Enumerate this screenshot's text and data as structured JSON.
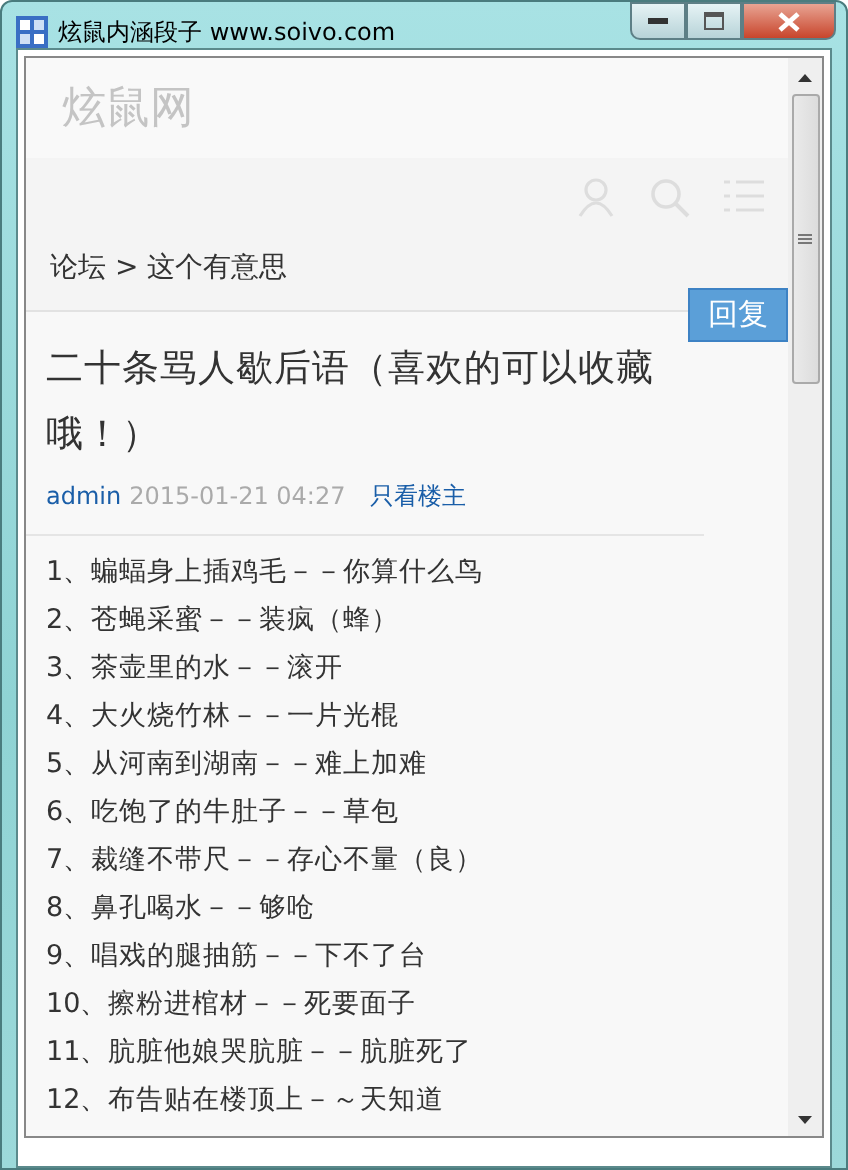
{
  "window": {
    "title": "炫鼠内涵段子 www.soivo.com"
  },
  "site": {
    "logo": "炫鼠网"
  },
  "breadcrumb": "论坛 > 这个有意思",
  "reply_button": "回复",
  "post": {
    "title": "二十条骂人歇后语（喜欢的可以收藏哦！）",
    "author": "admin",
    "time": "2015-01-21 04:27",
    "filter_link": "只看楼主",
    "lines": [
      "1、蝙蝠身上插鸡毛－－你算什么鸟",
      "2、苍蝇采蜜－－装疯（蜂）",
      "3、茶壶里的水－－滚开",
      "4、大火烧竹林－－一片光棍",
      "5、从河南到湖南－－难上加难",
      "6、吃饱了的牛肚子－－草包",
      "7、裁缝不带尺－－存心不量（良）",
      "8、鼻孔喝水－－够呛",
      "9、唱戏的腿抽筋－－下不了台",
      "10、擦粉进棺材－－死要面子",
      "11、肮脏他娘哭肮脏－－肮脏死了",
      "12、布告贴在楼顶上－～天知道"
    ]
  }
}
